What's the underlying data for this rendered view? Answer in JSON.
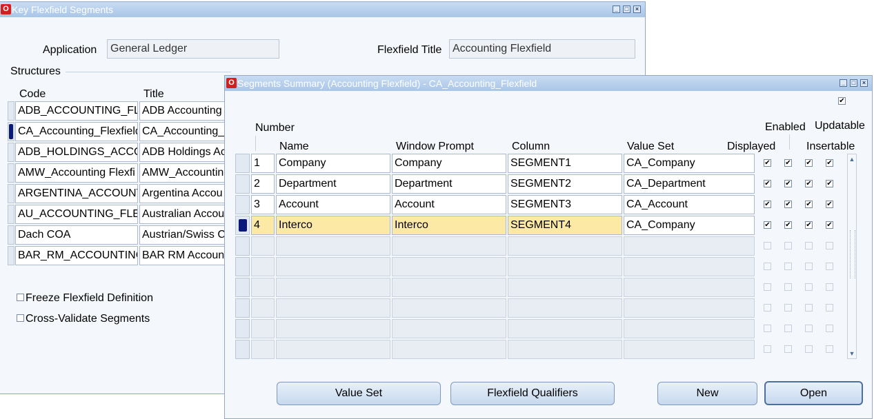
{
  "back_window": {
    "title": "Key Flexfield Segments",
    "application_label": "Application",
    "application_value": "General Ledger",
    "flexfield_title_label": "Flexfield Title",
    "flexfield_title_value": "Accounting Flexfield",
    "structures_label": "Structures",
    "col_code": "Code",
    "col_title": "Title",
    "rows": [
      {
        "code": "ADB_ACCOUNTING_FLEX",
        "title": "ADB Accounting"
      },
      {
        "code": "CA_Accounting_Flexfield",
        "title": "CA_Accounting_"
      },
      {
        "code": "ADB_HOLDINGS_ACCO",
        "title": "ADB Holdings Ac"
      },
      {
        "code": "AMW_Accounting Flexfi",
        "title": "AMW_Accountin"
      },
      {
        "code": "ARGENTINA_ACCOUNT",
        "title": "Argentina Accou"
      },
      {
        "code": "AU_ACCOUNTING_FLEX",
        "title": "Australian Accou"
      },
      {
        "code": "Dach COA",
        "title": "Austrian/Swiss C"
      },
      {
        "code": "BAR_RM_ACCOUNTING",
        "title": "BAR RM Accoun"
      }
    ],
    "freeze_label": "Freeze Flexfield Definition",
    "crossval_label": "Cross-Validate Segments"
  },
  "front_window": {
    "title": "Segments Summary (Accounting Flexfield) - CA_Accounting_Flexfield",
    "col_number": "Number",
    "col_name": "Name",
    "col_prompt": "Window Prompt",
    "col_column": "Column",
    "col_valueset": "Value Set",
    "col_displayed": "Displayed",
    "col_enabled": "Enabled",
    "col_insertable": "Insertable",
    "col_updatable": "Updatable",
    "rows": [
      {
        "number": "1",
        "name": "Company",
        "prompt": "Company",
        "column": "SEGMENT1",
        "valueset": "CA_Company"
      },
      {
        "number": "2",
        "name": "Department",
        "prompt": "Department",
        "column": "SEGMENT2",
        "valueset": "CA_Department"
      },
      {
        "number": "3",
        "name": "Account",
        "prompt": "Account",
        "column": "SEGMENT3",
        "valueset": "CA_Account"
      },
      {
        "number": "4",
        "name": "Interco",
        "prompt": "Interco",
        "column": "SEGMENT4",
        "valueset": "CA_Company"
      }
    ],
    "btn_valueset": "Value Set",
    "btn_qualifiers": "Flexfield Qualifiers",
    "btn_new": "New",
    "btn_open": "Open",
    "check_mark": "✔"
  }
}
